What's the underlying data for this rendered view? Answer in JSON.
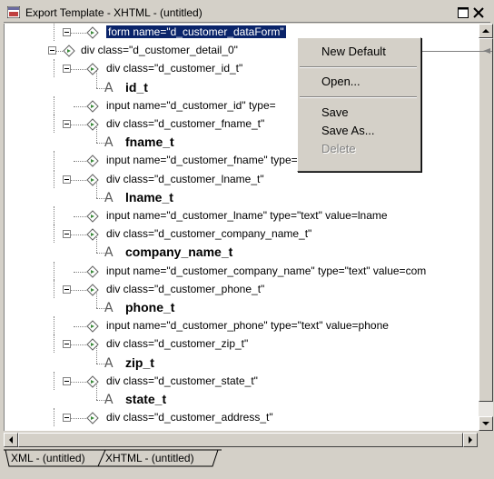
{
  "window": {
    "title": "Export Template - XHTML - (untitled)",
    "restore_icon": "restore-icon",
    "close_icon": "close-icon"
  },
  "tree": {
    "rows": [
      {
        "label": "form name=\"d_customer_dataForm\"",
        "kind": "node",
        "selected": true
      },
      {
        "label": "div class=\"d_customer_detail_0\"",
        "kind": "node"
      },
      {
        "label": "div class=\"d_customer_id_t\"",
        "kind": "node"
      },
      {
        "label": "id_t",
        "kind": "text"
      },
      {
        "label": "input name=\"d_customer_id\" type=",
        "kind": "node"
      },
      {
        "label": "div class=\"d_customer_fname_t\"",
        "kind": "node"
      },
      {
        "label": "fname_t",
        "kind": "text"
      },
      {
        "label": "input name=\"d_customer_fname\" type=\"text\" value=fname",
        "kind": "node"
      },
      {
        "label": "div class=\"d_customer_lname_t\"",
        "kind": "node"
      },
      {
        "label": "lname_t",
        "kind": "text"
      },
      {
        "label": "input name=\"d_customer_lname\" type=\"text\" value=lname",
        "kind": "node"
      },
      {
        "label": "div class=\"d_customer_company_name_t\"",
        "kind": "node"
      },
      {
        "label": "company_name_t",
        "kind": "text"
      },
      {
        "label": "input name=\"d_customer_company_name\" type=\"text\" value=com",
        "kind": "node"
      },
      {
        "label": "div class=\"d_customer_phone_t\"",
        "kind": "node"
      },
      {
        "label": "phone_t",
        "kind": "text"
      },
      {
        "label": "input name=\"d_customer_phone\" type=\"text\" value=phone",
        "kind": "node"
      },
      {
        "label": "div class=\"d_customer_zip_t\"",
        "kind": "node"
      },
      {
        "label": "zip_t",
        "kind": "text"
      },
      {
        "label": "div class=\"d_customer_state_t\"",
        "kind": "node"
      },
      {
        "label": "state_t",
        "kind": "text"
      },
      {
        "label": "div class=\"d_customer_address_t\"",
        "kind": "node"
      }
    ]
  },
  "context_menu": {
    "items": [
      {
        "label": "New Default",
        "enabled": true
      },
      {
        "label": "Open...",
        "enabled": true
      },
      {
        "label": "Save",
        "enabled": true
      },
      {
        "label": "Save As...",
        "enabled": true
      },
      {
        "label": "Delete",
        "enabled": false
      }
    ]
  },
  "tabs": [
    {
      "label": "XML - (untitled)",
      "active": false
    },
    {
      "label": "XHTML - (untitled)",
      "active": true
    }
  ],
  "colors": {
    "selection": "#0a246a",
    "window_bg": "#d4d0c8",
    "tree_bg": "#ffffff"
  }
}
